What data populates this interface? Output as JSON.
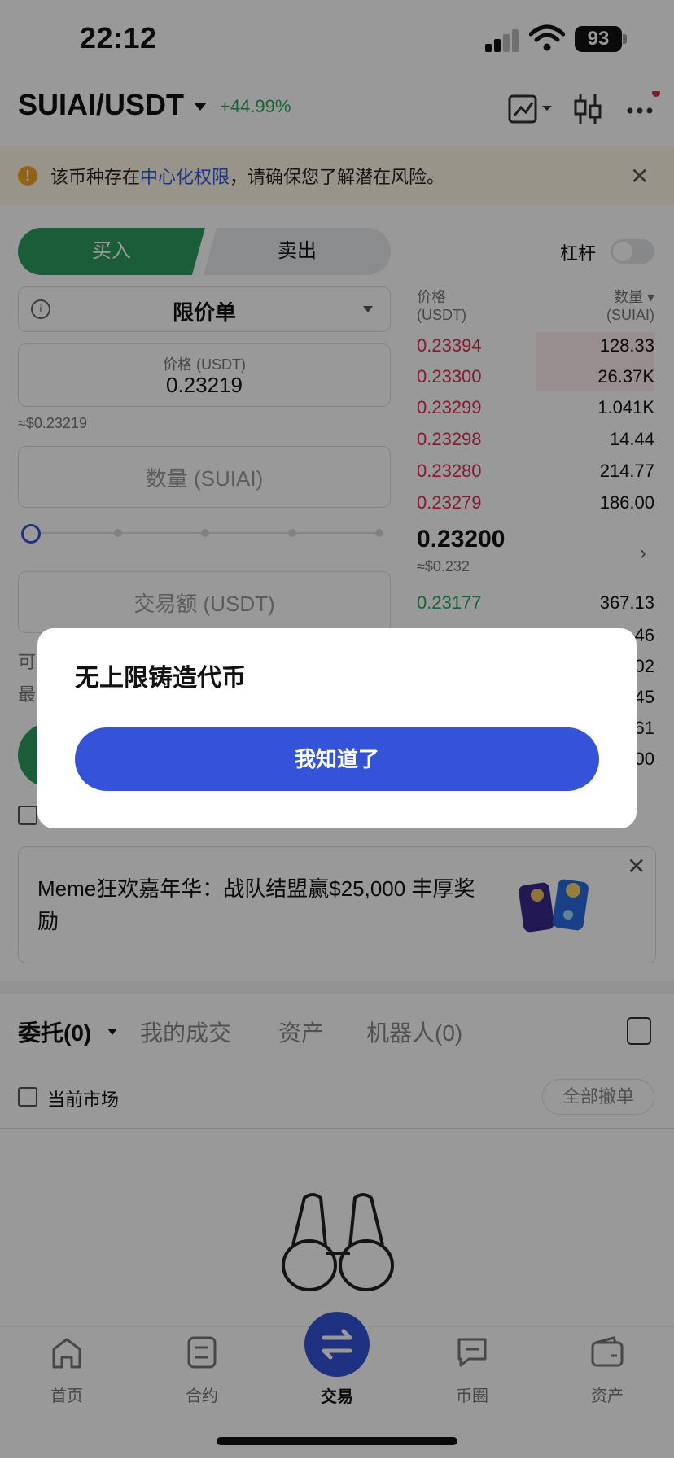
{
  "status_bar": {
    "time": "22:12",
    "battery": "93"
  },
  "header": {
    "pair": "SUIAI/USDT",
    "change": "+44.99%"
  },
  "warning": {
    "prefix": "该币种存在",
    "link": "中心化权限",
    "suffix": "，请确保您了解潜在风险。"
  },
  "trade_form": {
    "buy_label": "买入",
    "sell_label": "卖出",
    "leverage_label": "杠杆",
    "order_type": "限价单",
    "price_label": "价格 (USDT)",
    "price_value": "0.23219",
    "price_approx": "≈$0.23219",
    "quantity_placeholder": "数量 (SUIAI)",
    "amount_placeholder": "交易额 (USDT)",
    "available_prefix": "可",
    "max_prefix": "最"
  },
  "orderbook": {
    "price_header": "价格\n(USDT)",
    "qty_header": "数量 ▾\n(SUIAI)",
    "asks": [
      {
        "price": "0.23394",
        "qty": "128.33"
      },
      {
        "price": "0.23300",
        "qty": "26.37K"
      },
      {
        "price": "0.23299",
        "qty": "1.041K"
      },
      {
        "price": "0.23298",
        "qty": "14.44"
      },
      {
        "price": "0.23280",
        "qty": "214.77"
      },
      {
        "price": "0.23279",
        "qty": "186.00"
      }
    ],
    "mid_price": "0.23200",
    "mid_usd": "≈$0.232",
    "bids": [
      {
        "price": "0.23177",
        "qty": "367.13"
      }
    ],
    "hidden_qty_fragments": [
      "46",
      "02",
      "45",
      "61",
      "00"
    ]
  },
  "banner": {
    "text": "Meme狂欢嘉年华：战队结盟赢$25,000 丰厚奖励"
  },
  "orders": {
    "tabs": [
      "委托(0)",
      "我的成交",
      "资产",
      "机器人(0)"
    ],
    "current_market_label": "当前市场",
    "cancel_all_label": "全部撤单"
  },
  "bottom_nav": {
    "items": [
      {
        "label": "首页",
        "icon": "home-icon"
      },
      {
        "label": "合约",
        "icon": "contract-icon"
      },
      {
        "label": "交易",
        "icon": "swap-icon"
      },
      {
        "label": "币圈",
        "icon": "chat-icon"
      },
      {
        "label": "资产",
        "icon": "wallet-icon"
      }
    ]
  },
  "modal": {
    "title": "无上限铸造代币",
    "button_label": "我知道了"
  },
  "colors": {
    "buy": "#2e9c5e",
    "ask": "#d9304f",
    "bid": "#26a65b",
    "primary": "#3553d8"
  }
}
